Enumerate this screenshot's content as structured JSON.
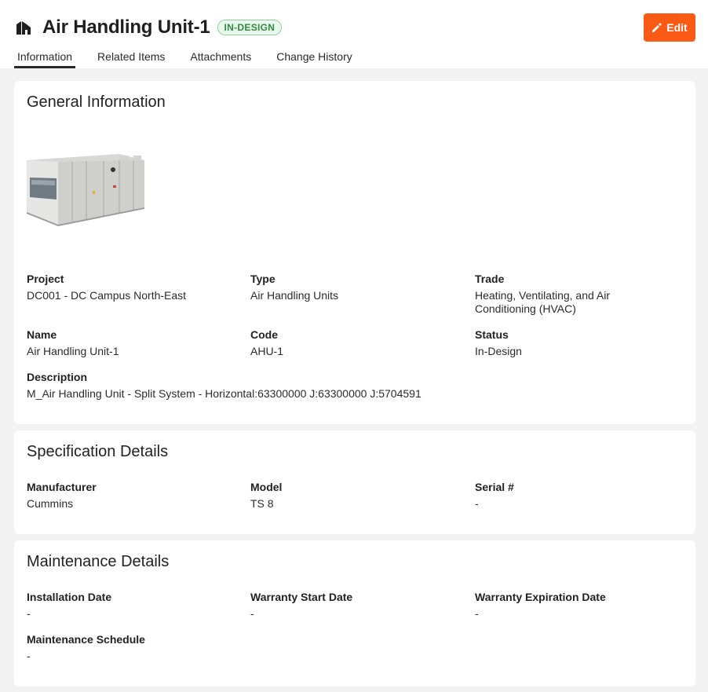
{
  "header": {
    "title": "Air Handling Unit-1",
    "status_badge": "IN-DESIGN",
    "edit_label": "Edit",
    "icon": "asset-building-icon"
  },
  "tabs": [
    {
      "label": "Information",
      "active": true
    },
    {
      "label": "Related Items",
      "active": false
    },
    {
      "label": "Attachments",
      "active": false
    },
    {
      "label": "Change History",
      "active": false
    }
  ],
  "general": {
    "title": "General Information",
    "fields": {
      "project": {
        "label": "Project",
        "value": "DC001 - DC Campus North-East"
      },
      "type": {
        "label": "Type",
        "value": "Air Handling Units"
      },
      "trade": {
        "label": "Trade",
        "value": "Heating, Ventilating, and Air Conditioning (HVAC)"
      },
      "name": {
        "label": "Name",
        "value": "Air Handling Unit-1"
      },
      "code": {
        "label": "Code",
        "value": "AHU-1"
      },
      "status": {
        "label": "Status",
        "value": "In-Design"
      },
      "description": {
        "label": "Description",
        "value": "M_Air Handling Unit - Split System - Horizontal:63300000 J:63300000 J:5704591"
      }
    }
  },
  "specification": {
    "title": "Specification Details",
    "fields": {
      "manufacturer": {
        "label": "Manufacturer",
        "value": "Cummins"
      },
      "model": {
        "label": "Model",
        "value": "TS 8"
      },
      "serial": {
        "label": "Serial #",
        "value": "-"
      }
    }
  },
  "maintenance": {
    "title": "Maintenance Details",
    "fields": {
      "installation": {
        "label": "Installation Date",
        "value": "-"
      },
      "warranty_start": {
        "label": "Warranty Start Date",
        "value": "-"
      },
      "warranty_expiration": {
        "label": "Warranty Expiration Date",
        "value": "-"
      },
      "schedule": {
        "label": "Maintenance Schedule",
        "value": "-"
      }
    }
  },
  "colors": {
    "accent": "#fa5a14",
    "badge_green": "#2e8b3f",
    "page_bg": "#f2f2f2"
  }
}
